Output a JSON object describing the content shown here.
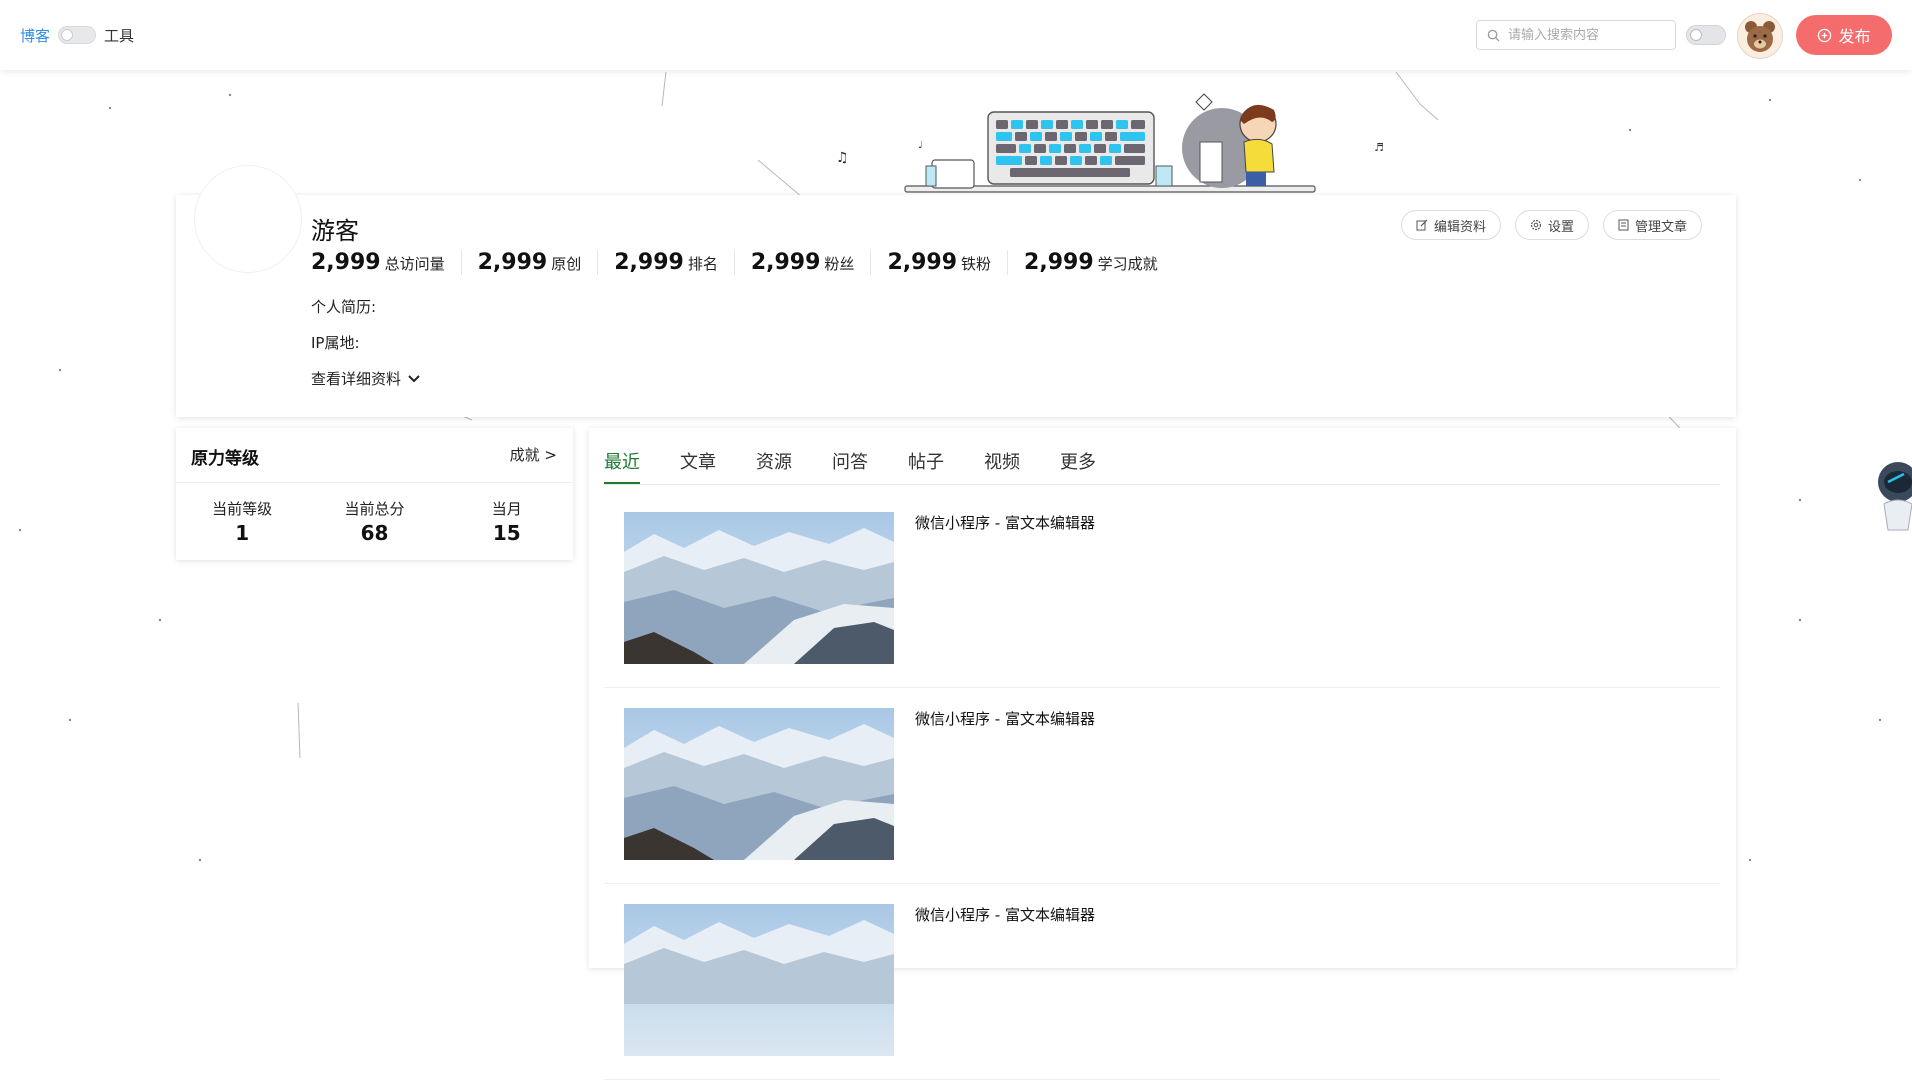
{
  "header": {
    "blog_label": "博客",
    "tool_label": "工具",
    "search_placeholder": "请输入搜索内容",
    "publish_label": "发布"
  },
  "profile": {
    "name": "游客",
    "stats": [
      {
        "value": "2,999",
        "label": "总访问量"
      },
      {
        "value": "2,999",
        "label": "原创"
      },
      {
        "value": "2,999",
        "label": "排名"
      },
      {
        "value": "2,999",
        "label": "粉丝"
      },
      {
        "value": "2,999",
        "label": "铁粉"
      },
      {
        "value": "2,999",
        "label": "学习成就"
      }
    ],
    "bio_label": "个人简历:",
    "ip_label": "IP属地:",
    "detail_label": "查看详细资料",
    "actions": {
      "edit": "编辑资料",
      "settings": "设置",
      "manage": "管理文章"
    }
  },
  "level": {
    "title": "原力等级",
    "achievement_link": "成就 >",
    "items": [
      {
        "label": "当前等级",
        "value": "1"
      },
      {
        "label": "当前总分",
        "value": "68"
      },
      {
        "label": "当月",
        "value": "15"
      }
    ]
  },
  "tabs": [
    "最近",
    "文章",
    "资源",
    "问答",
    "帖子",
    "视频",
    "更多"
  ],
  "articles": [
    {
      "title": "微信小程序 - 富文本编辑器"
    },
    {
      "title": "微信小程序 - 富文本编辑器"
    },
    {
      "title": "微信小程序 - 富文本编辑器"
    }
  ],
  "colors": {
    "accent_blue": "#2f8de4",
    "publish_red": "#f56c6c",
    "tab_active_green": "#1e7b34"
  }
}
